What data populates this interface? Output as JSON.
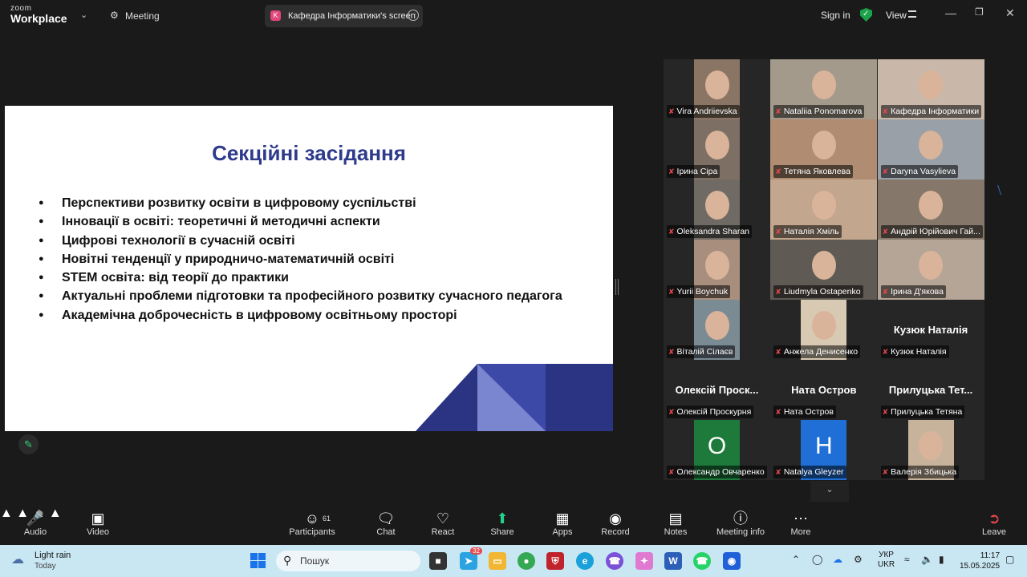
{
  "titlebar": {
    "brand_top": "zoom",
    "brand_bottom": "Workplace",
    "meeting_label": "Meeting",
    "sharing_label": "Кафедра Інформатики's screen",
    "sharing_initial": "K",
    "signin_label": "Sign in",
    "view_label": "View"
  },
  "slide": {
    "title": "Секційні засідання",
    "bullets": [
      "Перспективи розвитку освіти в цифровому суспільстві",
      "Інновації в освіті: теоретичні й методичні аспекти",
      "Цифрові технології в сучасній освіті",
      "Новітні тенденції у природничо-математичній освіті",
      "STEM освіта: від теорії до практики",
      "Актуальні проблеми підготовки та професійного розвитку сучасного педагога",
      "Академічна доброчесність в цифровому освітньому просторі"
    ],
    "colors": {
      "title": "#2e3a8c",
      "deco_dark": "#2b3483",
      "deco_mid": "#3d49a6",
      "deco_light": "#7a86d0"
    }
  },
  "participants": [
    {
      "name": "Vira Andriievska",
      "video": "person"
    },
    {
      "name": "Nataliia Ponomarova",
      "video": "person"
    },
    {
      "name": "Кафедра Інформатики",
      "video": "person",
      "active": true
    },
    {
      "name": "Ірина Сіра",
      "video": "person"
    },
    {
      "name": "Тетяна Яковлева",
      "video": "person"
    },
    {
      "name": "Daryna Vasylieva",
      "video": "person"
    },
    {
      "name": "Oleksandra Sharan",
      "video": "person"
    },
    {
      "name": "Наталія Хміль",
      "video": "person"
    },
    {
      "name": "Андрій Юрійович Гай...",
      "video": "person"
    },
    {
      "name": "Yurii Boychuk",
      "video": "person"
    },
    {
      "name": "Liudmyla Ostapenko",
      "video": "person"
    },
    {
      "name": "Ірина Д'якова",
      "video": "person"
    },
    {
      "name": "Віталій Сілаєв",
      "video": "person"
    },
    {
      "name": "Анжела Денисенко",
      "video": "photo"
    },
    {
      "name": "Кузюк Наталія",
      "video": "none",
      "display": "Кузюк Наталія"
    },
    {
      "name": "Олексій Проскурня",
      "video": "none",
      "display": "Олексій Проск..."
    },
    {
      "name": "Ната Остров",
      "video": "none",
      "display": "Ната Остров"
    },
    {
      "name": "Прилуцька Тетяна",
      "video": "none",
      "display": "Прилуцька Тет..."
    },
    {
      "name": "Олександр Овчаренко",
      "video": "letter",
      "letter": "O",
      "color": "#1e7a3a"
    },
    {
      "name": "Natalya Gleyzer",
      "video": "letter",
      "letter": "H",
      "color": "#1f6fd6"
    },
    {
      "name": "Валерія Збицька",
      "video": "photo"
    }
  ],
  "toolbar": {
    "audio": "Audio",
    "video": "Video",
    "participants": "Participants",
    "participants_count": "61",
    "chat": "Chat",
    "react": "React",
    "share": "Share",
    "apps": "Apps",
    "record": "Record",
    "notes": "Notes",
    "meeting_info": "Meeting info",
    "more": "More",
    "leave": "Leave"
  },
  "taskbar": {
    "weather_title": "Light rain",
    "weather_sub": "Today",
    "search_placeholder": "Пошук",
    "lang_top": "УКР",
    "lang_bottom": "UKR",
    "time": "11:17",
    "date": "15.05.2025",
    "telegram_badge": "32"
  }
}
